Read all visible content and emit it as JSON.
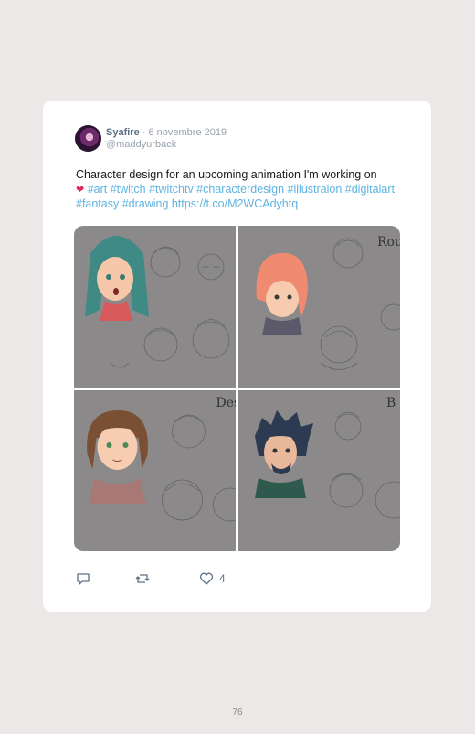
{
  "tweet": {
    "author_name": "Syafire",
    "separator": " · ",
    "date": "6 novembre 2019",
    "handle": "@maddyurback",
    "text_plain": "Character design for an upcoming animation I'm working on",
    "emoji": "❤",
    "text_tags": " #art #twitch #twitchtv #characterdesign #illustraion #digitalart #fantasy #drawing https://t.co/M2WCAdyhtq",
    "like_count": "4"
  },
  "images": [
    {
      "name": "teal-hair-girl-sketch",
      "labels": []
    },
    {
      "name": "orange-hair-sketch",
      "labels": [
        "Rou"
      ]
    },
    {
      "name": "brown-hair-girl-sketch",
      "labels": [
        "Des"
      ]
    },
    {
      "name": "dark-hair-bearded-sketch",
      "labels": [
        "B"
      ]
    }
  ],
  "icons": {
    "reply": "reply-icon",
    "retweet": "retweet-icon",
    "like": "heart-icon"
  },
  "colors": {
    "background": "#ece8e7",
    "card": "#ffffff",
    "link": "#5fb3e0",
    "name": "#5b6f86",
    "muted": "#9aa3ad"
  },
  "footer": {
    "page_number": "76"
  }
}
